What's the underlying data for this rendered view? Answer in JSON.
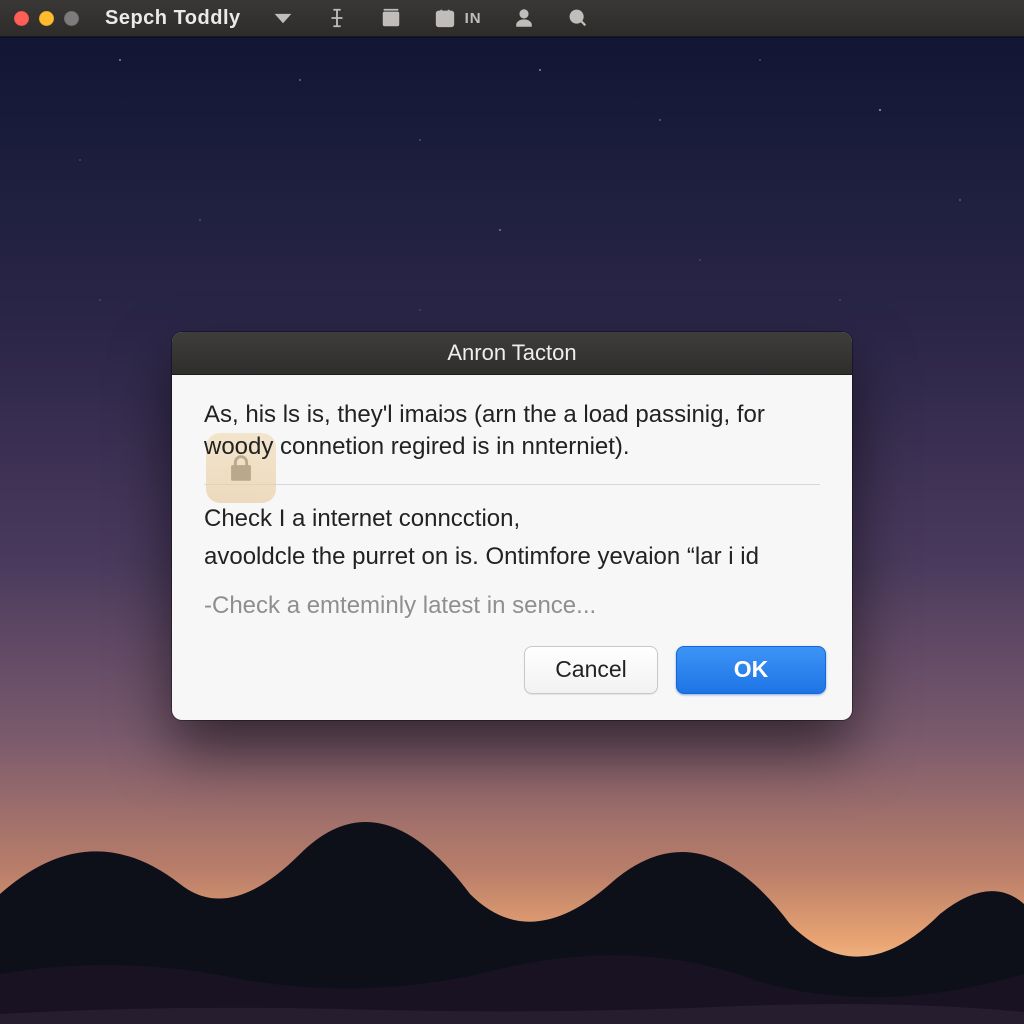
{
  "menubar": {
    "app_name": "Sepch Toddly",
    "icons": {
      "dropdown": "chevron-down-icon",
      "text": "text-cursor-icon",
      "box": "align-box-icon",
      "calendar": "calendar-icon",
      "calendar_badge": "IN",
      "user": "user-icon",
      "search": "search-icon"
    }
  },
  "dialog": {
    "title": "Anron Tacton",
    "primary_text": "As, his ls is, they'l imaiɔs (arn the a  load passinig, for woody connetion regired is in nnterniet).",
    "secondary_lines": [
      "Check I a internet connсction,",
      "avooldcle the purret on is. Ontimfore yevaion “lar i id"
    ],
    "tail_text": "-Check a emteminly latest in sence...",
    "buttons": {
      "cancel": "Cancel",
      "ok": "OK"
    }
  }
}
